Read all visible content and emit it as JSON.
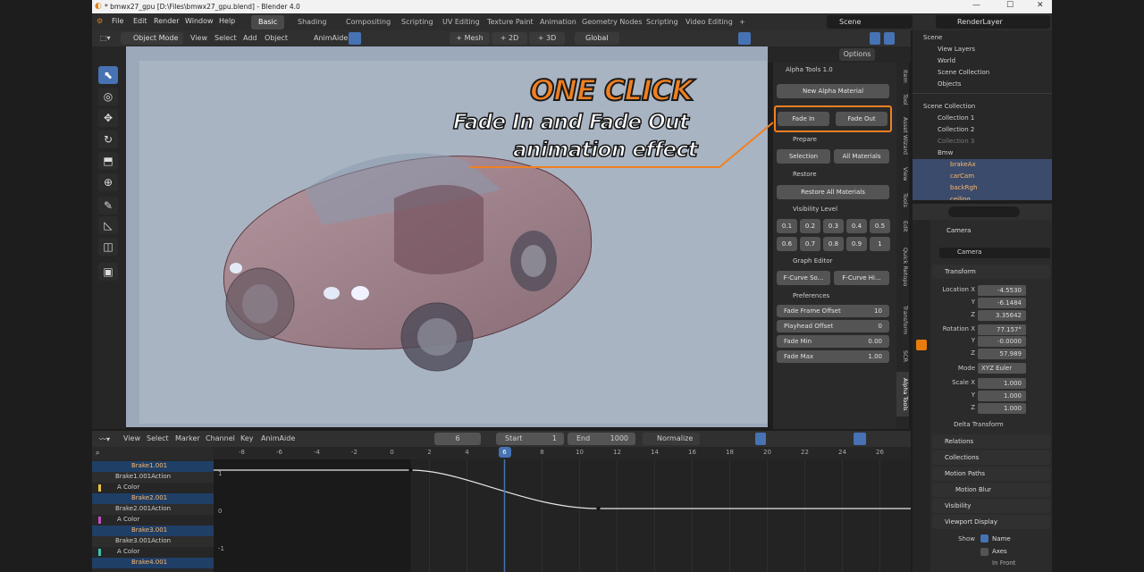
{
  "window": {
    "title": "* bmwx27_gpu [D:\\Files\\bmwx27_gpu.blend] - Blender 4.0",
    "controls": [
      "—",
      "☐",
      "✕"
    ]
  },
  "menu": [
    "File",
    "Edit",
    "Render",
    "Window",
    "Help"
  ],
  "workspaces": [
    "Basic",
    "Shading",
    "Compositing",
    "Scripting",
    "UV Editing",
    "Texture Paint",
    "Animation",
    "Geometry Nodes",
    "Scripting",
    "Video Editing"
  ],
  "workspace_add": "+",
  "scene_field": "Scene",
  "render_layer": "RenderLayer",
  "viewport_header": {
    "mode": "Object Mode",
    "items": [
      "View",
      "Select",
      "Add",
      "Object"
    ],
    "addon": "AnimAide",
    "mesh_btns": [
      "+ Mesh",
      "+ 2D",
      "+ 3D"
    ],
    "orientation": "Global",
    "options": "Options"
  },
  "overlay": {
    "headline": "ONE CLICK",
    "line1": "Fade In and Fade Out",
    "line2": "animation effect"
  },
  "npanel": {
    "title": "Alpha Tools 1.0",
    "new_material": "New Alpha Material",
    "fade_in": "Fade In",
    "fade_out": "Fade Out",
    "prepare": "Prepare",
    "selection": "Selection",
    "all_materials": "All Materials",
    "restore": "Restore",
    "restore_all": "Restore All Materials",
    "visibility_level": "Visibility Level",
    "levels": [
      "0.1",
      "0.2",
      "0.3",
      "0.4",
      "0.5",
      "0.6",
      "0.7",
      "0.8",
      "0.9",
      "1"
    ],
    "graph_editor": "Graph Editor",
    "fcurve1": "F-Curve So...",
    "fcurve2": "F-Curve Hi...",
    "preferences": "Preferences",
    "fields": [
      {
        "label": "Fade Frame Offset",
        "value": "10"
      },
      {
        "label": "Playhead Offset",
        "value": "0"
      },
      {
        "label": "Fade Min",
        "value": "0.00"
      },
      {
        "label": "Fade Max",
        "value": "1.00"
      }
    ]
  },
  "vtabs": [
    "Item",
    "Tool",
    "Asset Wizard",
    "View",
    "Tools",
    "Edit",
    "Quick Retopo",
    "Transform",
    "SCR",
    "Alpha Tools"
  ],
  "outliner": {
    "rows": [
      {
        "name": "Scene"
      },
      {
        "name": "View Layers"
      },
      {
        "name": "World"
      },
      {
        "name": "Scene Collection"
      },
      {
        "name": "Objects"
      },
      {
        "name": "Scene Collection"
      },
      {
        "name": "Collection 1"
      },
      {
        "name": "Collection 2"
      },
      {
        "name": "Collection 3"
      },
      {
        "name": "Bmw"
      },
      {
        "name": "brakeAx"
      },
      {
        "name": "carCam"
      },
      {
        "name": "backRgh"
      },
      {
        "name": "ceiling"
      }
    ]
  },
  "properties": {
    "object": "Camera",
    "data": "Camera",
    "transform": "Transform",
    "location": {
      "label": "Location X",
      "x": "-4.5530",
      "y": "-6.1484",
      "z": "3.35642"
    },
    "rotation": {
      "label": "Rotation X",
      "x": "77.157°",
      "y": "-0.0000",
      "z": "57.989"
    },
    "mode_label": "Mode",
    "mode": "XYZ Euler",
    "scale": {
      "label": "Scale X",
      "x": "1.000",
      "y": "1.000",
      "z": "1.000"
    },
    "axis_y": "Y",
    "axis_z": "Z",
    "delta": "Delta Transform",
    "sections": [
      "Relations",
      "Collections",
      "Motion Paths",
      "Motion Blur",
      "Visibility",
      "Viewport Display"
    ],
    "show": "Show",
    "name_cb": "Name",
    "axes_cb": "Axes",
    "in_front": "In Front"
  },
  "graph": {
    "header_items": [
      "View",
      "Select",
      "Marker",
      "Channel",
      "Key",
      "AnimAide"
    ],
    "current_frame": "6",
    "start_label": "Start",
    "start": "1",
    "end_label": "End",
    "end": "1000",
    "normalize": "Normalize",
    "frames": [
      "-8",
      "-6",
      "-4",
      "-2",
      "0",
      "2",
      "4",
      "6",
      "8",
      "10",
      "12",
      "14",
      "16",
      "18",
      "20",
      "22",
      "24",
      "26"
    ],
    "playhead": "6",
    "yvals": [
      "1",
      "0",
      "-1"
    ],
    "channels": [
      {
        "name": "Brake1.001",
        "kind": "obj"
      },
      {
        "name": "Brake1.001Action",
        "kind": "act"
      },
      {
        "name": "A Color",
        "kind": "col"
      },
      {
        "name": "Brake2.001",
        "kind": "obj"
      },
      {
        "name": "Brake2.001Action",
        "kind": "act"
      },
      {
        "name": "A Color",
        "kind": "col"
      },
      {
        "name": "Brake3.001",
        "kind": "obj"
      },
      {
        "name": "Brake3.001Action",
        "kind": "act"
      },
      {
        "name": "A Color",
        "kind": "col"
      },
      {
        "name": "Brake4.001",
        "kind": "obj"
      }
    ]
  },
  "colors": {
    "accent": "#4772b3",
    "highlight": "#f08020",
    "selected_text": "#ffb86c"
  }
}
